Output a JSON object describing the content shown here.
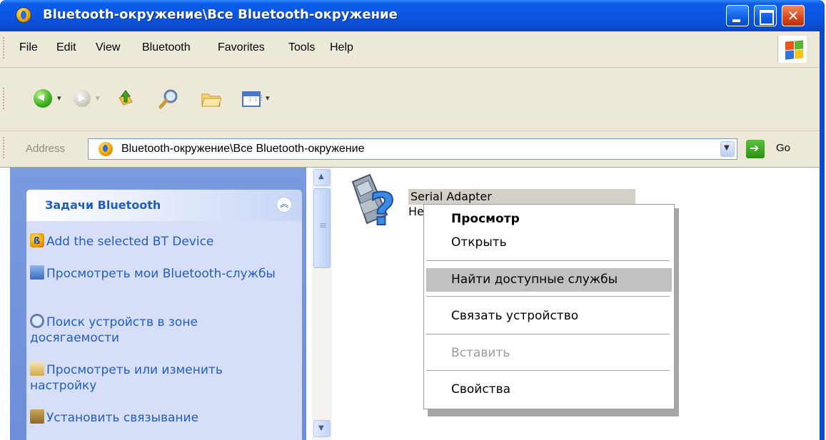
{
  "window": {
    "title": "Bluetooth-окружение\\Все Bluetooth-окружение"
  },
  "menubar": {
    "items": [
      "File",
      "Edit",
      "View",
      "Bluetooth",
      "Favorites",
      "Tools",
      "Help"
    ]
  },
  "toolbar": {
    "buttons": [
      "back-icon",
      "forward-icon",
      "up-folder-icon",
      "search-icon",
      "folders-icon",
      "views-icon"
    ]
  },
  "address": {
    "label": "Address",
    "value": "Bluetooth-окружение\\Все Bluetooth-окружение",
    "go_label": "Go"
  },
  "tasks": {
    "title": "Задачи Bluetooth",
    "items": [
      "Add the selected BT Device",
      "Просмотреть мои Bluetooth-службы",
      "Поиск устройств в зоне досягаемости",
      "Просмотреть или изменить настройку",
      "Установить связывание"
    ]
  },
  "device": {
    "name": "Serial Adapter",
    "status": "Не"
  },
  "context_menu": {
    "items": [
      {
        "label": "Просмотр",
        "bold": true
      },
      {
        "label": "Открыть"
      },
      {
        "label": "Найти доступные службы",
        "highlighted": true
      },
      {
        "label": "Связать устройство"
      },
      {
        "label": "Вставить",
        "disabled": true
      },
      {
        "label": "Свойства"
      }
    ]
  },
  "colors": {
    "titlebar": "#0a55e0",
    "taskpane": "#6d8ed8",
    "link": "#215dc6",
    "menu_highlight": "#c1c1c1"
  }
}
